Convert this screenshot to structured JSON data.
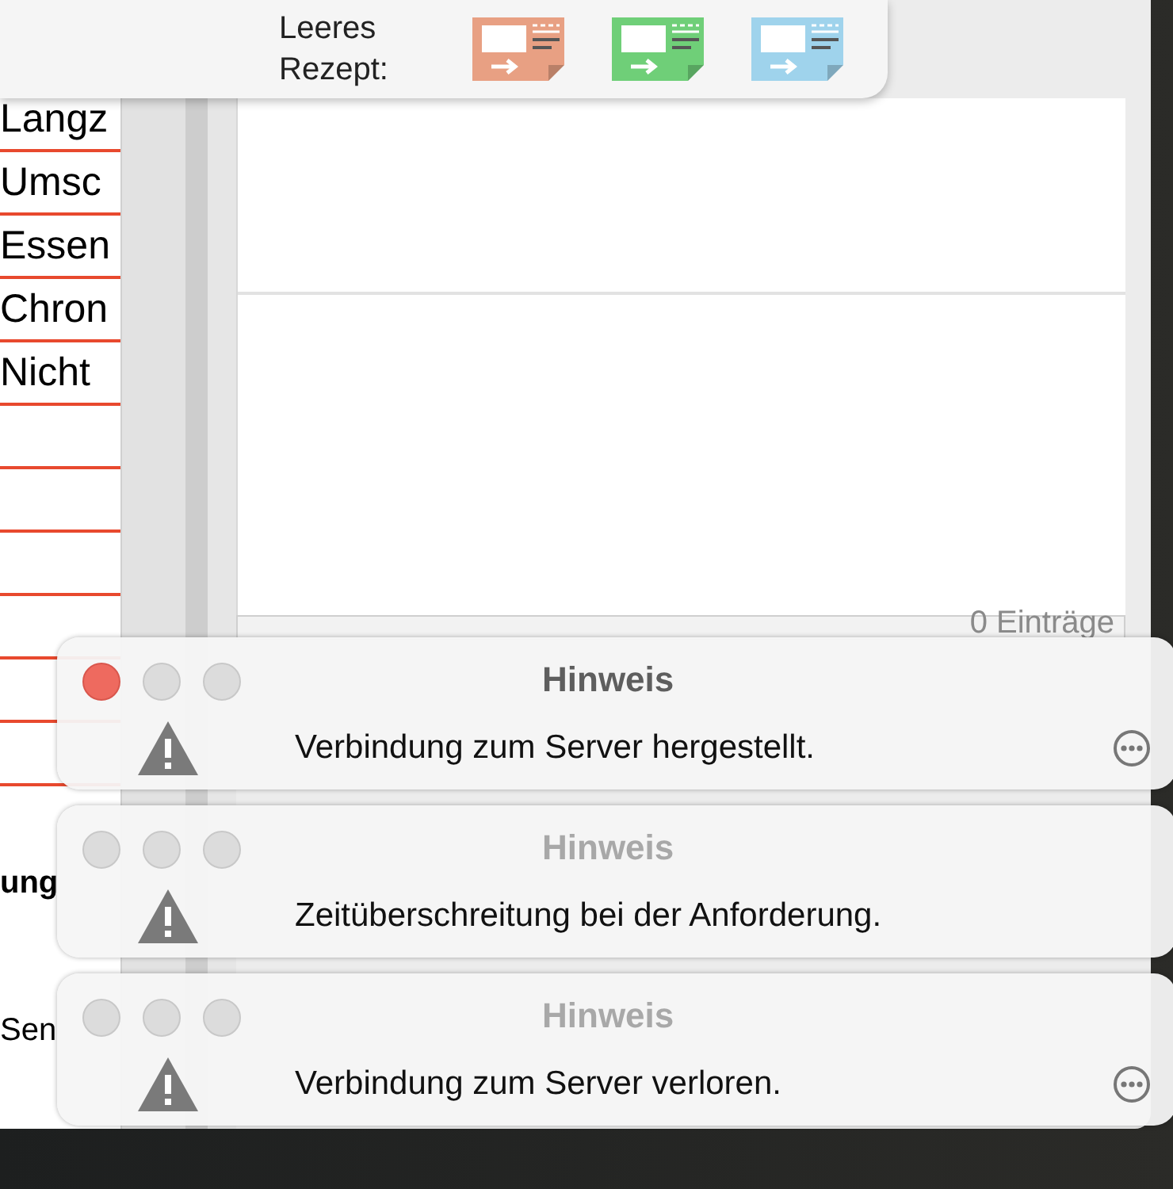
{
  "popover": {
    "label": "Leeres Rezept:",
    "templates": [
      {
        "color": "#e8a083"
      },
      {
        "color": "#6fcf78"
      },
      {
        "color": "#9fd3ec"
      }
    ]
  },
  "back_window": {
    "list_items": [
      "Langz",
      "Umsc",
      "Essen",
      "Chron",
      "Nicht"
    ],
    "lower_texts": [
      {
        "text": "ung",
        "bold": true
      },
      {
        "text": "Sen",
        "bold": false
      }
    ],
    "footer": "0 Einträge"
  },
  "notifications": [
    {
      "title": "Hinweis",
      "message": "Verbindung zum Server hergestellt.",
      "active": true,
      "menu": true
    },
    {
      "title": "Hinweis",
      "message": "Zeitüberschreitung bei der Anforderung.",
      "active": false,
      "menu": false
    },
    {
      "title": "Hinweis",
      "message": "Verbindung zum Server verloren.",
      "active": false,
      "menu": true
    }
  ]
}
